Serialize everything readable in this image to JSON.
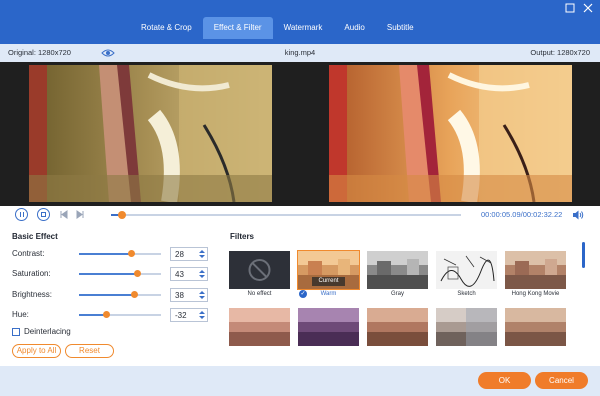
{
  "window": {
    "tabs": [
      {
        "label": "Rotate & Crop",
        "active": false
      },
      {
        "label": "Effect & Filter",
        "active": true
      },
      {
        "label": "Watermark",
        "active": false
      },
      {
        "label": "Audio",
        "active": false
      },
      {
        "label": "Subtitle",
        "active": false
      }
    ],
    "restore_icon": "restore-icon",
    "close_icon": "close-icon",
    "accent_color": "#2b66c9",
    "button_color": "#f07c2a"
  },
  "infobar": {
    "original": "Original: 1280x720",
    "file_name": "king.mp4",
    "output": "Output: 1280x720"
  },
  "player": {
    "time_current": "00:00:05.09",
    "time_separator": "/",
    "time_total": "00:02:32.22",
    "progress": 0.03
  },
  "basic_effect": {
    "title": "Basic Effect",
    "rows": [
      {
        "label": "Contrast:",
        "value": "28",
        "level": 0.64
      },
      {
        "label": "Saturation:",
        "value": "43",
        "level": 0.71
      },
      {
        "label": "Brightness:",
        "value": "38",
        "level": 0.68
      },
      {
        "label": "Hue:",
        "value": "-32",
        "level": 0.33
      }
    ],
    "deinterlacing": "Deinterlacing",
    "apply_to_all": "Apply to All",
    "reset": "Reset"
  },
  "filters": {
    "title": "Filters",
    "current_tag": "Current",
    "items": [
      {
        "label": "No effect"
      },
      {
        "label": "Warm"
      },
      {
        "label": "Gray"
      },
      {
        "label": "Sketch"
      },
      {
        "label": "Hong Kong Movie"
      }
    ]
  },
  "footer": {
    "ok": "OK",
    "cancel": "Cancel"
  }
}
